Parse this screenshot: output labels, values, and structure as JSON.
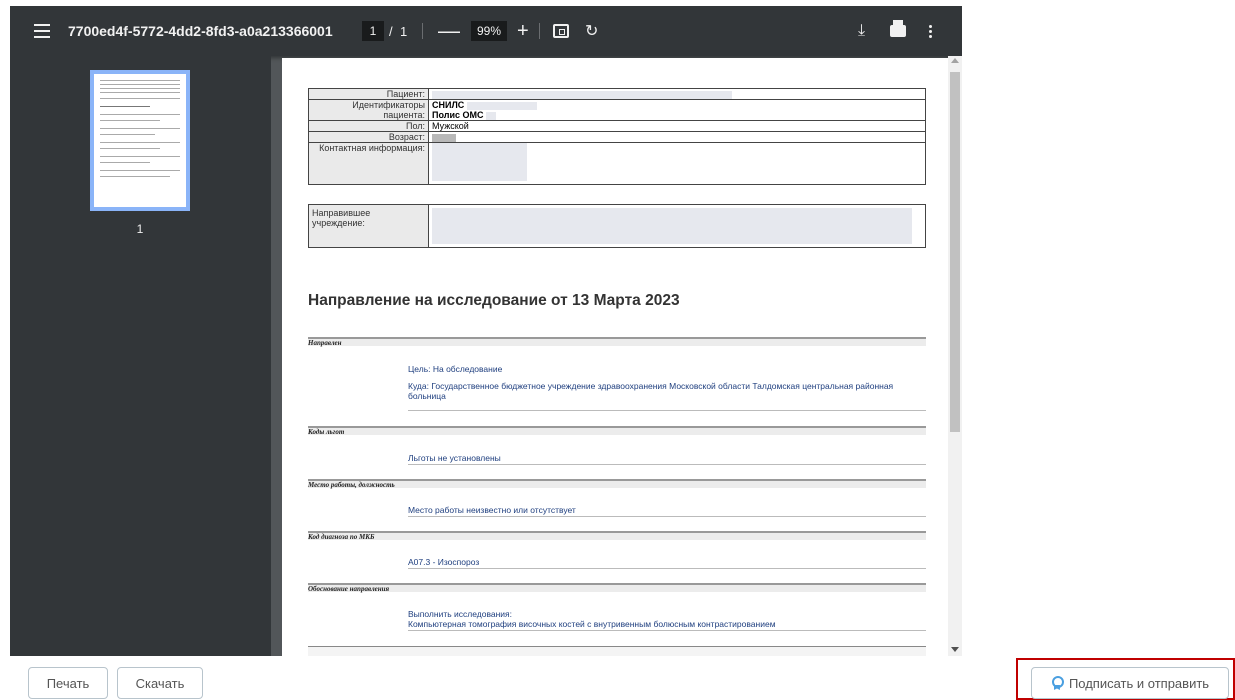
{
  "toolbar": {
    "title": "7700ed4f-5772-4dd2-8fd3-a0a213366001",
    "page_current": "1",
    "page_separator": "/",
    "page_total": "1",
    "zoom_out": "—",
    "zoom": "99%",
    "zoom_in": "+",
    "rotate_icon": "↻",
    "download_icon": "⤓"
  },
  "sidebar": {
    "thumbnail_label": "1"
  },
  "document": {
    "patient_info": {
      "patient_label": "Пациент:",
      "ids_label": "Идентификаторы пациента:",
      "snils_label": "СНИЛС",
      "oms_label": "Полис ОМС",
      "sex_label": "Пол:",
      "sex_value": "Мужской",
      "age_label": "Возраст:",
      "contact_label": "Контактная информация:"
    },
    "referring_org_label": "Направившее учреждение:",
    "heading": "Направление на исследование от 13 Марта 2023",
    "sections": {
      "directed_title": "Направлен",
      "purpose": "Цель: На обследование",
      "destination": "Куда: Государственное бюджетное учреждение здравоохранения Московской области Талдомская центральная районная больница",
      "benefits_title": "Коды льгот",
      "benefits_text": "Льготы не установлены",
      "work_title": "Место работы, должность",
      "work_text": "Место работы неизвестно или отсутствует",
      "mkb_title": "Код диагноза по МКБ",
      "mkb_text": "A07.3 - Изоспороз",
      "reason_title": "Обоснование направления",
      "reason_line1": "Выполнить исследования:",
      "reason_line2": "Компьютерная томография височных костей с внутривенным болюсным контрастированием"
    }
  },
  "footer": {
    "print_label": "Печать",
    "download_label": "Скачать",
    "sign_label": "Подписать и отправить"
  }
}
